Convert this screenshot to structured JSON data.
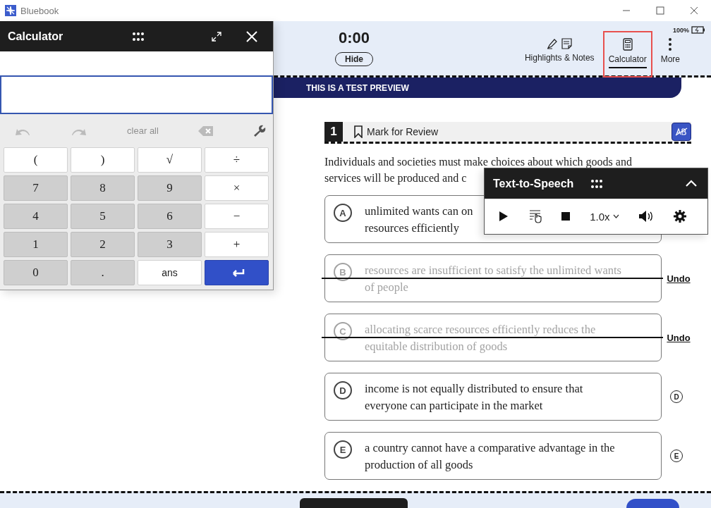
{
  "window": {
    "title": "Bluebook"
  },
  "header": {
    "timer": "0:00",
    "hide_label": "Hide",
    "battery": "100%",
    "tools": [
      {
        "kind": "highlights",
        "label": "Highlights & Notes",
        "selected": false,
        "highlighted": false
      },
      {
        "kind": "calculator",
        "label": "Calculator",
        "selected": true,
        "highlighted": true
      },
      {
        "kind": "more",
        "label": "More",
        "selected": false,
        "highlighted": false
      }
    ]
  },
  "banner": "THIS IS A TEST PREVIEW",
  "question": {
    "number": "1",
    "mark_label": "Mark for Review",
    "marked": false,
    "eliminator_on": true,
    "stem_lines": [
      "Individuals and societies must make choices about which goods and",
      "services will be produced and c"
    ],
    "options": [
      {
        "letter": "A",
        "lines": [
          "unlimited wants can on",
          "resources efficiently"
        ],
        "crossed": false
      },
      {
        "letter": "B",
        "lines": [
          "resources are insufficient to satisfy the unlimited wants",
          "of people"
        ],
        "crossed": true,
        "undo_label": "Undo"
      },
      {
        "letter": "C",
        "lines": [
          "allocating scarce resources efficiently reduces the",
          "equitable distribution of goods"
        ],
        "crossed": true,
        "undo_label": "Undo"
      },
      {
        "letter": "D",
        "lines": [
          "income is not equally distributed to ensure that",
          "everyone can participate in the market"
        ],
        "crossed": false,
        "eliminate_label": "D"
      },
      {
        "letter": "E",
        "lines": [
          "a country cannot have a comparative advantage in the",
          "production of all goods"
        ],
        "crossed": false,
        "eliminate_label": "E"
      }
    ]
  },
  "footer": {
    "buttons": [
      {
        "kind": "dark"
      },
      {
        "kind": "primary"
      }
    ]
  },
  "calculator": {
    "title": "Calculator",
    "toolbar": [
      {
        "kind": "undo",
        "disabled": true
      },
      {
        "kind": "redo",
        "disabled": true
      },
      {
        "kind": "clear",
        "label": "clear all",
        "disabled": true
      },
      {
        "kind": "backspace",
        "disabled": true
      },
      {
        "kind": "settings",
        "disabled": false
      }
    ],
    "keys": [
      {
        "kind": "func",
        "label": "("
      },
      {
        "kind": "func",
        "label": ")"
      },
      {
        "kind": "func",
        "label": "√"
      },
      {
        "kind": "func",
        "label": "÷"
      },
      {
        "kind": "digit",
        "label": "7"
      },
      {
        "kind": "digit",
        "label": "8"
      },
      {
        "kind": "digit",
        "label": "9"
      },
      {
        "kind": "func",
        "label": "×"
      },
      {
        "kind": "digit",
        "label": "4"
      },
      {
        "kind": "digit",
        "label": "5"
      },
      {
        "kind": "digit",
        "label": "6"
      },
      {
        "kind": "func",
        "label": "−"
      },
      {
        "kind": "digit",
        "label": "1"
      },
      {
        "kind": "digit",
        "label": "2"
      },
      {
        "kind": "digit",
        "label": "3"
      },
      {
        "kind": "func",
        "label": "+"
      },
      {
        "kind": "digit",
        "label": "0"
      },
      {
        "kind": "digit",
        "label": "."
      },
      {
        "kind": "func",
        "label": "ans"
      },
      {
        "kind": "enter"
      }
    ]
  },
  "tts": {
    "title": "Text-to-Speech",
    "expanded": true,
    "controls": [
      {
        "kind": "play"
      },
      {
        "kind": "click-read"
      },
      {
        "kind": "stop"
      },
      {
        "kind": "speed",
        "label": "1.0x"
      },
      {
        "kind": "volume"
      },
      {
        "kind": "settings"
      }
    ]
  }
}
